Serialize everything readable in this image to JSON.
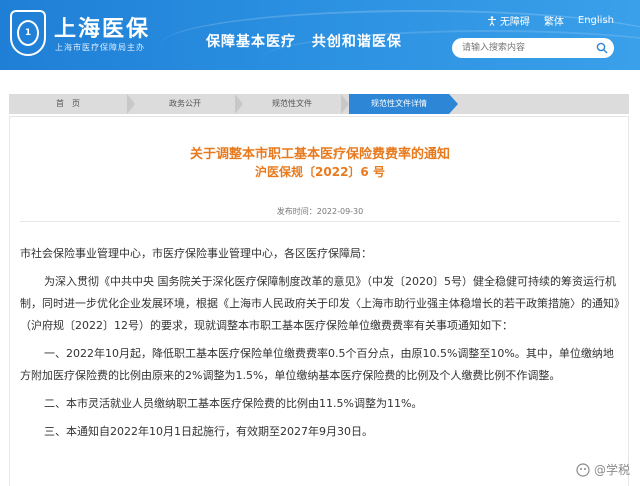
{
  "header": {
    "logo_title": "上海医保",
    "logo_sub": "上海市医疗保障局主办",
    "slogan_1": "保障基本医疗",
    "slogan_2": "共创和谐医保",
    "toplinks": {
      "accessibility": "无障碍",
      "traditional": "繁体",
      "english": "English"
    },
    "search_placeholder": "请输入搜索内容"
  },
  "breadcrumb": {
    "items": [
      "首　页",
      "政务公开",
      "规范性文件",
      "规范性文件详情"
    ],
    "active_color": "#2d86d6"
  },
  "article": {
    "title": "关于调整本市职工基本医疗保险费费率的通知",
    "doc_number": "沪医保规〔2022〕6 号",
    "date": "发布时间：2022-09-30",
    "title_color": "#e87a1e",
    "paragraphs": [
      "市社会保险事业管理中心，市医疗保险事业管理中心，各区医疗保障局：",
      "为深入贯彻《中共中央 国务院关于深化医疗保障制度改革的意见》（中发〔2020〕5号）健全稳健可持续的筹资运行机制，同时进一步优化企业发展环境，根据《上海市人民政府关于印发〈上海市助行业强主体稳增长的若干政策措施〉的通知》（沪府规〔2022〕12号）的要求，现就调整本市职工基本医疗保险单位缴费费率有关事项通知如下：",
      "一、2022年10月起，降低职工基本医疗保险单位缴费费率0.5个百分点，由原10.5%调整至10%。其中，单位缴纳地方附加医疗保险费的比例由原来的2%调整为1.5%，单位缴纳基本医疗保险费的比例及个人缴费比例不作调整。",
      "二、本市灵活就业人员缴纳职工基本医疗保险费的比例由11.5%调整为11%。",
      "三、本通知自2022年10月1日起施行，有效期至2027年9月30日。"
    ]
  },
  "watermark": "@学税"
}
